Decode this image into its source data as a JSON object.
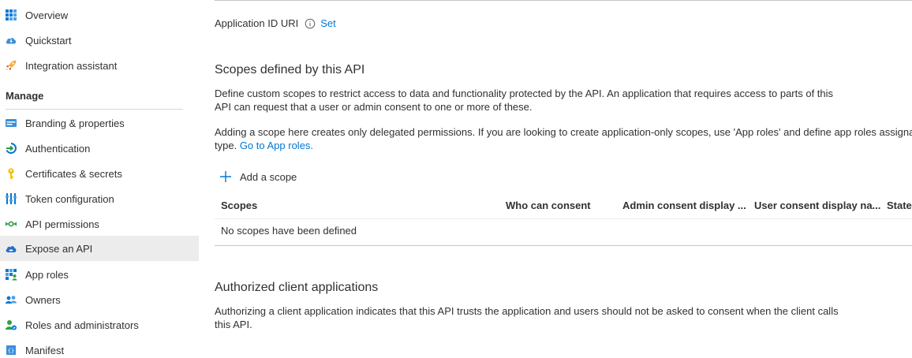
{
  "sidebar": {
    "items_top": [
      {
        "label": "Overview",
        "icon": "grid-icon"
      },
      {
        "label": "Quickstart",
        "icon": "cloud-bolt-icon"
      },
      {
        "label": "Integration assistant",
        "icon": "rocket-icon"
      }
    ],
    "manage_heading": "Manage",
    "items_manage": [
      {
        "label": "Branding & properties",
        "icon": "branding-icon"
      },
      {
        "label": "Authentication",
        "icon": "authentication-icon"
      },
      {
        "label": "Certificates & secrets",
        "icon": "key-icon"
      },
      {
        "label": "Token configuration",
        "icon": "token-config-icon"
      },
      {
        "label": "API permissions",
        "icon": "api-permissions-icon"
      },
      {
        "label": "Expose an API",
        "icon": "expose-api-cloud-icon",
        "active": true
      },
      {
        "label": "App roles",
        "icon": "app-roles-icon"
      },
      {
        "label": "Owners",
        "icon": "owners-icon"
      },
      {
        "label": "Roles and administrators",
        "icon": "roles-admins-icon"
      },
      {
        "label": "Manifest",
        "icon": "manifest-icon"
      }
    ]
  },
  "main": {
    "app_id_uri_label": "Application ID URI",
    "app_id_uri_set": "Set",
    "scopes_title": "Scopes defined by this API",
    "scopes_desc_line1": "Define custom scopes to restrict access to data and functionality protected by the API. An application that requires access to parts of this",
    "scopes_desc_line2": "API can request that a user or admin consent to one or more of these.",
    "scopes_note_line1": "Adding a scope here creates only delegated permissions. If you are looking to create application-only scopes, use 'App roles' and define app roles assignal",
    "scopes_note_line2_prefix": "type.",
    "scopes_note_link": "Go to App roles.",
    "add_scope_label": "Add a scope",
    "table": {
      "columns": [
        "Scopes",
        "Who can consent",
        "Admin consent display ...",
        "User consent display na...",
        "State"
      ],
      "empty_text": "No scopes have been defined"
    },
    "authorized_title": "Authorized client applications",
    "authorized_desc_line1": "Authorizing a client application indicates that this API trusts the application and users should not be asked to consent when the client calls",
    "authorized_desc_line2": "this API."
  },
  "colors": {
    "link": "#0078d4",
    "active_bg": "#ececec",
    "text": "#323130"
  }
}
